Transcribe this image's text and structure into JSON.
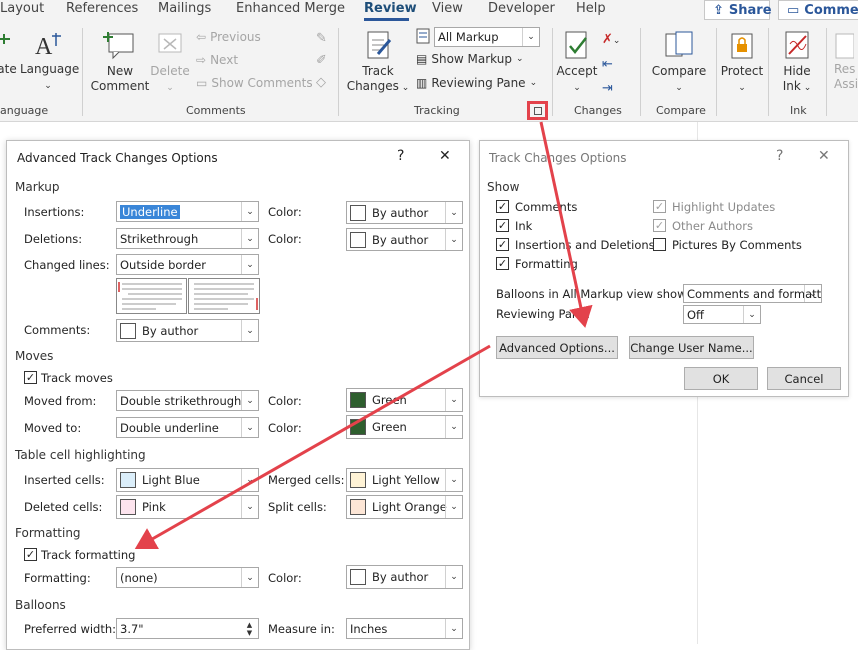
{
  "tabs": [
    "Layout",
    "References",
    "Mailings",
    "Enhanced Merge",
    "Review",
    "View",
    "Developer",
    "Help"
  ],
  "active_tab": "Review",
  "share_label": "Share",
  "comments_label": "Comments",
  "ribbon": {
    "translate_label": "ate",
    "language_label": "Language",
    "language_group": "anguage",
    "new_comment": [
      "New",
      "Comment"
    ],
    "delete": "Delete",
    "previous": "Previous",
    "next": "Next",
    "show_comments": "Show Comments",
    "comments_group": "Comments",
    "track_changes": [
      "Track",
      "Changes"
    ],
    "markup_combo": "All Markup",
    "show_markup": "Show Markup",
    "reviewing_pane": "Reviewing Pane",
    "tracking_group": "Tracking",
    "accept": "Accept",
    "changes_group": "Changes",
    "compare": "Compare",
    "compare_group": "Compare",
    "protect": "Protect",
    "hide_ink": [
      "Hide",
      "Ink"
    ],
    "ink_group": "Ink",
    "resume": [
      "Res",
      "Assi"
    ]
  },
  "tco": {
    "title": "Track Changes Options",
    "help": "?",
    "close": "✕",
    "show_label": "Show",
    "options": [
      {
        "label": "Comments",
        "checked": true,
        "disabled": false
      },
      {
        "label": "Ink",
        "checked": true,
        "disabled": false
      },
      {
        "label": "Insertions and Deletions",
        "checked": true,
        "disabled": false
      },
      {
        "label": "Formatting",
        "checked": true,
        "disabled": false
      },
      {
        "label": "Highlight Updates",
        "checked": true,
        "disabled": true
      },
      {
        "label": "Other Authors",
        "checked": true,
        "disabled": true
      },
      {
        "label": "Pictures By Comments",
        "checked": false,
        "disabled": false
      }
    ],
    "balloons_label": "Balloons in All Markup view show:",
    "balloons_value": "Comments and formatting",
    "reviewing_pane_label": "Reviewing Pane:",
    "reviewing_pane_value": "Off",
    "advanced_button": "Advanced Options...",
    "change_user_button": "Change User Name...",
    "ok": "OK",
    "cancel": "Cancel"
  },
  "atco": {
    "title": "Advanced Track Changes Options",
    "help": "?",
    "close": "✕",
    "markup_section": "Markup",
    "insertions_label": "Insertions:",
    "insertions_value": "Underline",
    "deletions_label": "Deletions:",
    "deletions_value": "Strikethrough",
    "changed_lines_label": "Changed lines:",
    "changed_lines_value": "Outside border",
    "comments_label": "Comments:",
    "comments_value": "By author",
    "color_label": "Color:",
    "by_author": "By author",
    "moves_section": "Moves",
    "track_moves": "Track moves",
    "moved_from_label": "Moved from:",
    "moved_from_value": "Double strikethrough",
    "moved_to_label": "Moved to:",
    "moved_to_value": "Double underline",
    "green": "Green",
    "table_section": "Table cell highlighting",
    "inserted_cells_label": "Inserted cells:",
    "inserted_cells_value": "Light Blue",
    "deleted_cells_label": "Deleted cells:",
    "deleted_cells_value": "Pink",
    "merged_cells_label": "Merged cells:",
    "merged_cells_value": "Light Yellow",
    "split_cells_label": "Split cells:",
    "split_cells_value": "Light Orange",
    "formatting_section": "Formatting",
    "track_formatting": "Track formatting",
    "formatting_label": "Formatting:",
    "formatting_value": "(none)",
    "balloons_section": "Balloons",
    "preferred_width_label": "Preferred width:",
    "preferred_width_value": "3.7\"",
    "measure_in_label": "Measure in:",
    "measure_in_value": "Inches"
  },
  "colors": {
    "accent": "#2b579a",
    "arrow": "#e3424b",
    "green": "#2e5e2e",
    "light_blue": "#dbeefa",
    "pink": "#fde4ee",
    "light_yellow": "#fff3d6",
    "light_orange": "#fde6d6"
  }
}
